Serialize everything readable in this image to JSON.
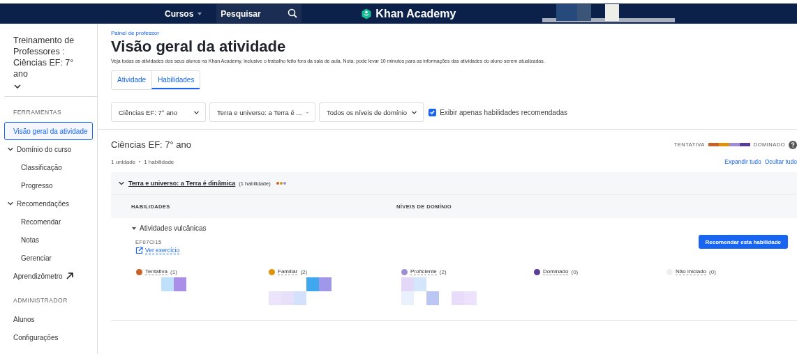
{
  "topbar": {
    "courses_menu": "Cursos",
    "search": {
      "placeholder": "Pesquisar"
    },
    "logo": "Khan Academy"
  },
  "sidebar": {
    "class_title": "Treinamento de Professores : Ciências EF: 7° ano",
    "sections": [
      {
        "heading": "FERRAMENTAS",
        "items": [
          {
            "label": "Visão geral da atividade",
            "kind": "link",
            "selected": true
          },
          {
            "label": "Domínio do curso",
            "kind": "group",
            "expanded": true,
            "children": [
              {
                "label": "Classificação",
                "selected": false
              },
              {
                "label": "Progresso",
                "selected": false
              }
            ]
          },
          {
            "label": "Recomendações",
            "kind": "group",
            "expanded": true,
            "children": [
              {
                "label": "Recomendar",
                "selected": false
              },
              {
                "label": "Notas",
                "selected": false
              },
              {
                "label": "Gerenciar",
                "selected": false
              }
            ]
          },
          {
            "label": "Aprendizômetro",
            "kind": "external",
            "selected": false
          }
        ]
      },
      {
        "heading": "ADMINISTRADOR",
        "items": [
          {
            "label": "Alunos",
            "kind": "link",
            "selected": false
          },
          {
            "label": "Configurações",
            "kind": "link",
            "selected": false
          }
        ]
      }
    ]
  },
  "main": {
    "breadcrumb": "Painel de professor",
    "title": "Visão geral da atividade",
    "description": "Veja todas as atividades dos seus alunos na Khan Academy, inclusive o trabalho feito fora da sala de aula. Nota: pode levar 10 minutos para as informações das atividades do aluno serem atualizadas.",
    "tabs": [
      {
        "label": "Atividade",
        "selected": false
      },
      {
        "label": "Habilidades",
        "selected": true
      }
    ],
    "filters": [
      {
        "label": "Ciências EF: 7° ano"
      },
      {
        "label": "Terra e universo: a Terra é ..."
      },
      {
        "label": "Todos os níveis de domínio"
      }
    ],
    "recommended_only": {
      "label": "Exibir apenas habilidades recomendadas",
      "checked": true
    },
    "course": {
      "title": "Ciências EF: 7° ano",
      "units": "1 unidade",
      "skills": "1 habilidade",
      "legend": {
        "start": "TENTATIVA",
        "end": "DOMINADO",
        "segments": [
          {
            "color": "#c8622a"
          },
          {
            "color": "#e0930f"
          },
          {
            "color": "#9d8ed6"
          },
          {
            "color": "#5a3d98"
          }
        ]
      },
      "expand_all": "Expandir tudo",
      "collapse_all": "Ocultar tudo",
      "unit": {
        "title": "Terra e universo: a Terra é dinâmica",
        "count": "(1 habilidade)",
        "expanded": true,
        "dots": [
          {
            "color": "#c8622a"
          },
          {
            "color": "#e0930f"
          },
          {
            "color": "#9d8ed6"
          }
        ],
        "columns": [
          "HABILIDADES",
          "NÍVEIS DE DOMÍNIO"
        ],
        "skills": [
          {
            "name": "Atividades vulcânicas",
            "expanded": true,
            "code": "EF07CI15",
            "link": "Ver exercício",
            "button": "Recomendar esta habilidade",
            "levels": [
              {
                "name": "Tentativa",
                "count": "(1)",
                "color": "#c8622a"
              },
              {
                "name": "Familiar",
                "count": "(2)",
                "color": "#e0930f"
              },
              {
                "name": "Proficiente",
                "count": "(2)",
                "color": "#9d8ed6"
              },
              {
                "name": "Dominado",
                "count": "(0)",
                "color": "#5a3d98"
              },
              {
                "name": "Não iniciado",
                "count": "(0)",
                "color": "#eeeeee"
              }
            ]
          }
        ]
      }
    }
  }
}
